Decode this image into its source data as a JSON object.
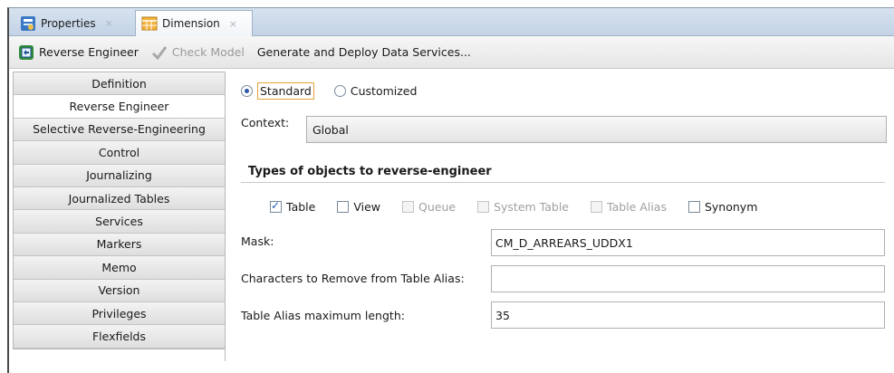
{
  "tabs": [
    {
      "label": "Properties",
      "icon": "properties-icon"
    },
    {
      "label": "Dimension",
      "icon": "dimension-icon"
    }
  ],
  "tab_close_glyph": "×",
  "toolbar": {
    "reverse_engineer": "Reverse Engineer",
    "check_model": "Check Model",
    "generate_deploy": "Generate and Deploy Data Services..."
  },
  "sidebar": {
    "items": [
      {
        "label": "Definition"
      },
      {
        "label": "Reverse Engineer"
      },
      {
        "label": "Selective Reverse-Engineering"
      },
      {
        "label": "Control"
      },
      {
        "label": "Journalizing"
      },
      {
        "label": "Journalized Tables"
      },
      {
        "label": "Services"
      },
      {
        "label": "Markers"
      },
      {
        "label": "Memo"
      },
      {
        "label": "Version"
      },
      {
        "label": "Privileges"
      },
      {
        "label": "Flexfields"
      }
    ],
    "active": "Reverse Engineer"
  },
  "main": {
    "mode_standard": "Standard",
    "mode_customized": "Customized",
    "selected_mode": "Standard",
    "context_label": "Context:",
    "context_value": "Global",
    "types_title": "Types of objects to reverse-engineer",
    "types": [
      {
        "label": "Table",
        "checked": true,
        "enabled": true
      },
      {
        "label": "View",
        "checked": false,
        "enabled": true
      },
      {
        "label": "Queue",
        "checked": false,
        "enabled": false
      },
      {
        "label": "System Table",
        "checked": false,
        "enabled": false
      },
      {
        "label": "Table Alias",
        "checked": false,
        "enabled": false
      },
      {
        "label": "Synonym",
        "checked": false,
        "enabled": true
      }
    ],
    "mask_label": "Mask:",
    "mask_value": "CM_D_ARREARS_UDDX1",
    "chars_remove_label": "Characters to Remove from Table Alias:",
    "chars_remove_value": "",
    "alias_max_label": "Table Alias maximum length:",
    "alias_max_value": "35"
  },
  "colors": {
    "tabbar": "#c3d3e6",
    "focus_outline": "#e8a33b",
    "check_accent": "#1f5bb5"
  }
}
